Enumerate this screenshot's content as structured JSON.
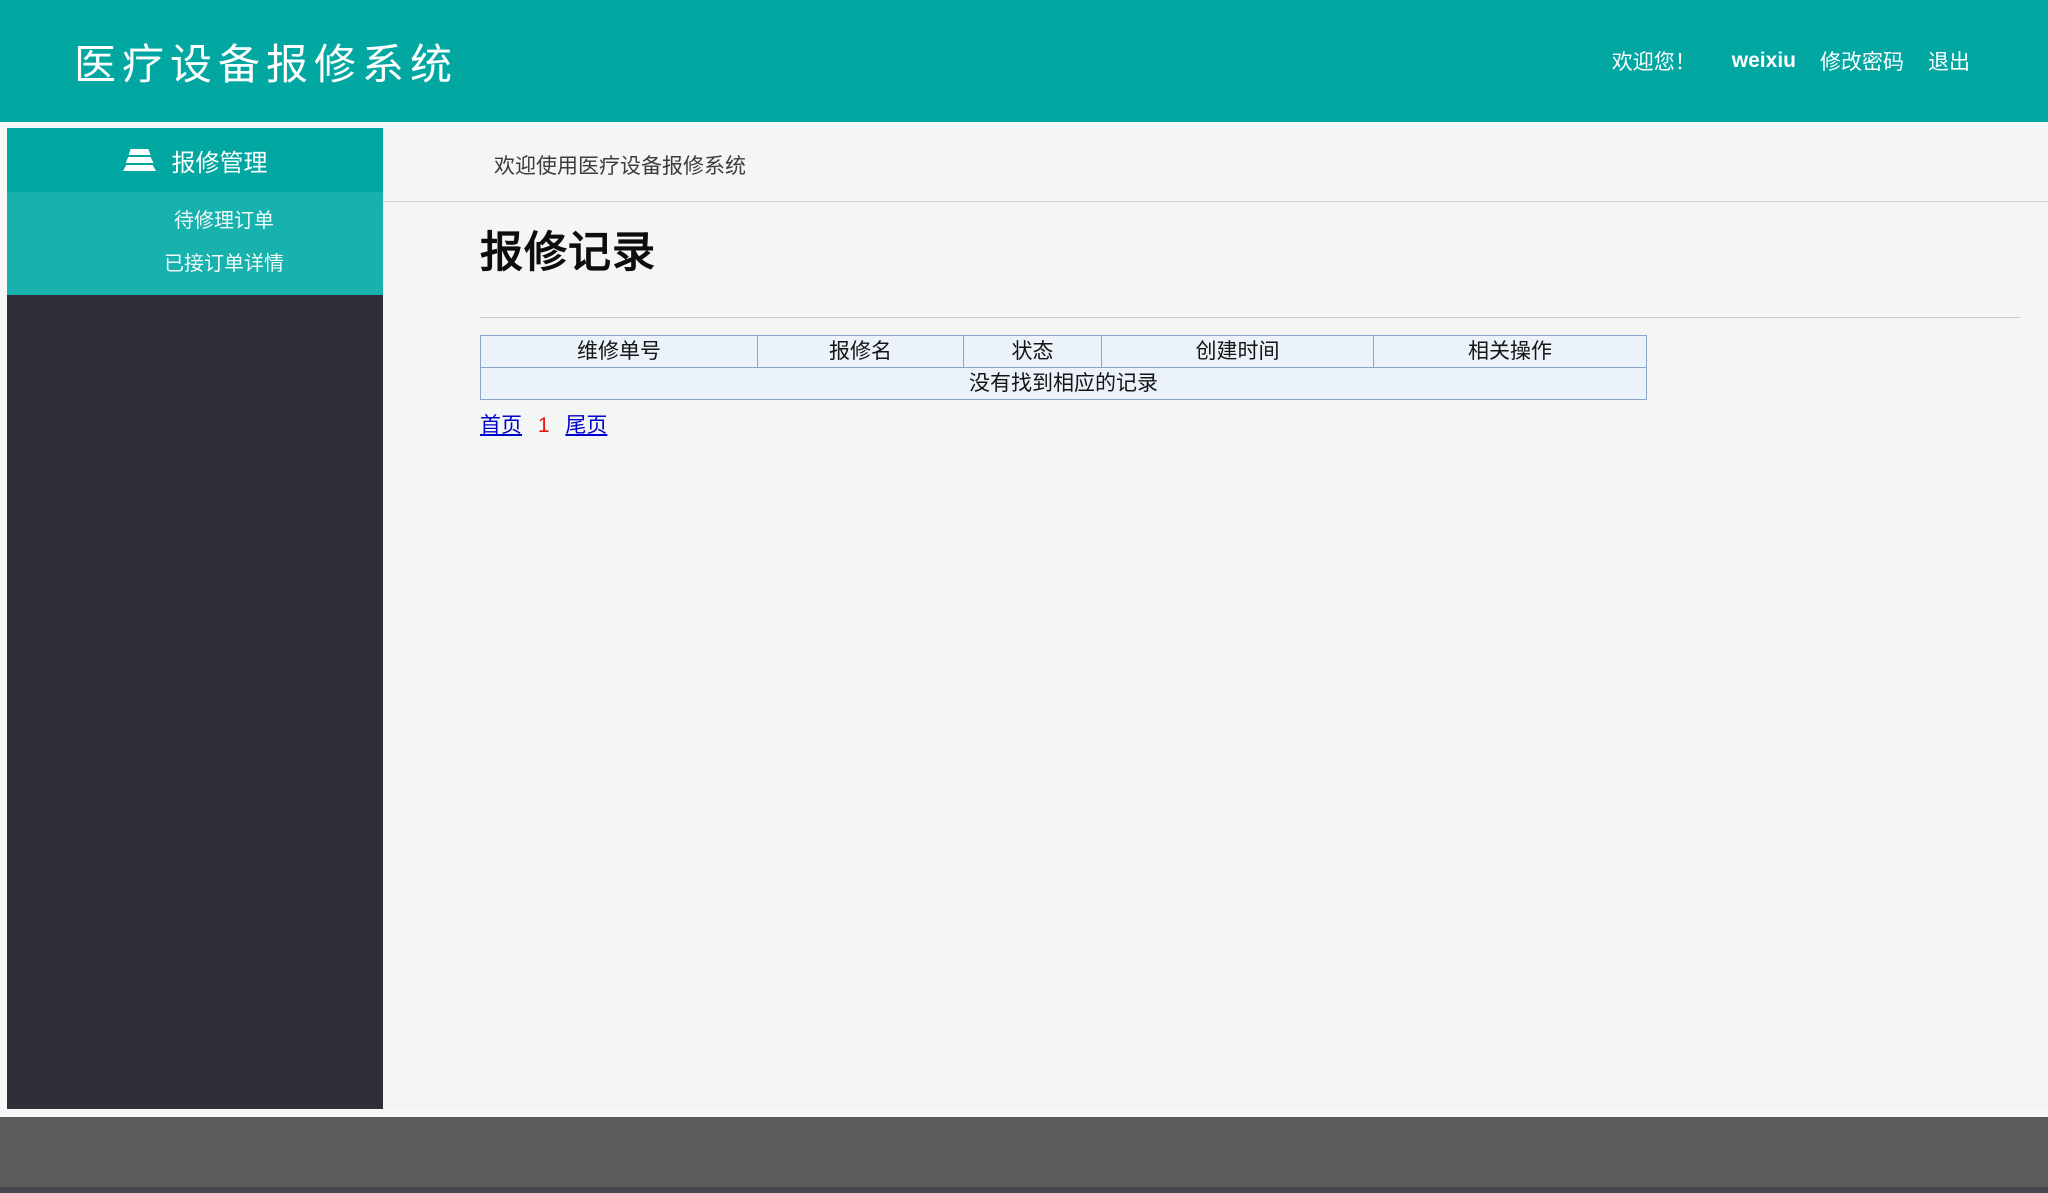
{
  "header": {
    "brand": "医疗设备报修系统",
    "welcome": "欢迎您！",
    "username": "weixiu",
    "change_password": "修改密码",
    "logout": "退出"
  },
  "sidebar": {
    "menu": {
      "label": "报修管理",
      "icon": "layers-stack-icon"
    },
    "items": [
      {
        "label": "待修理订单"
      },
      {
        "label": "已接订单详情"
      }
    ]
  },
  "main": {
    "breadcrumb": "欢迎使用医疗设备报修系统",
    "title": "报修记录",
    "table": {
      "columns": [
        "维修单号",
        "报修名",
        "状态",
        "创建时间",
        "相关操作"
      ],
      "rows": [],
      "empty_text": "没有找到相应的记录"
    },
    "pagination": {
      "first": "首页",
      "current": "1",
      "last": "尾页"
    }
  },
  "colors": {
    "header_teal": "#02a7a2",
    "submenu_teal": "#17b2ae",
    "sidebar_dark": "#302f37",
    "table_background": "#ecf2fa",
    "table_border": "#7f9db9",
    "link_blue": "#0000cc",
    "current_page_red": "#ee1111",
    "footer_gray": "#5b5b5b"
  }
}
